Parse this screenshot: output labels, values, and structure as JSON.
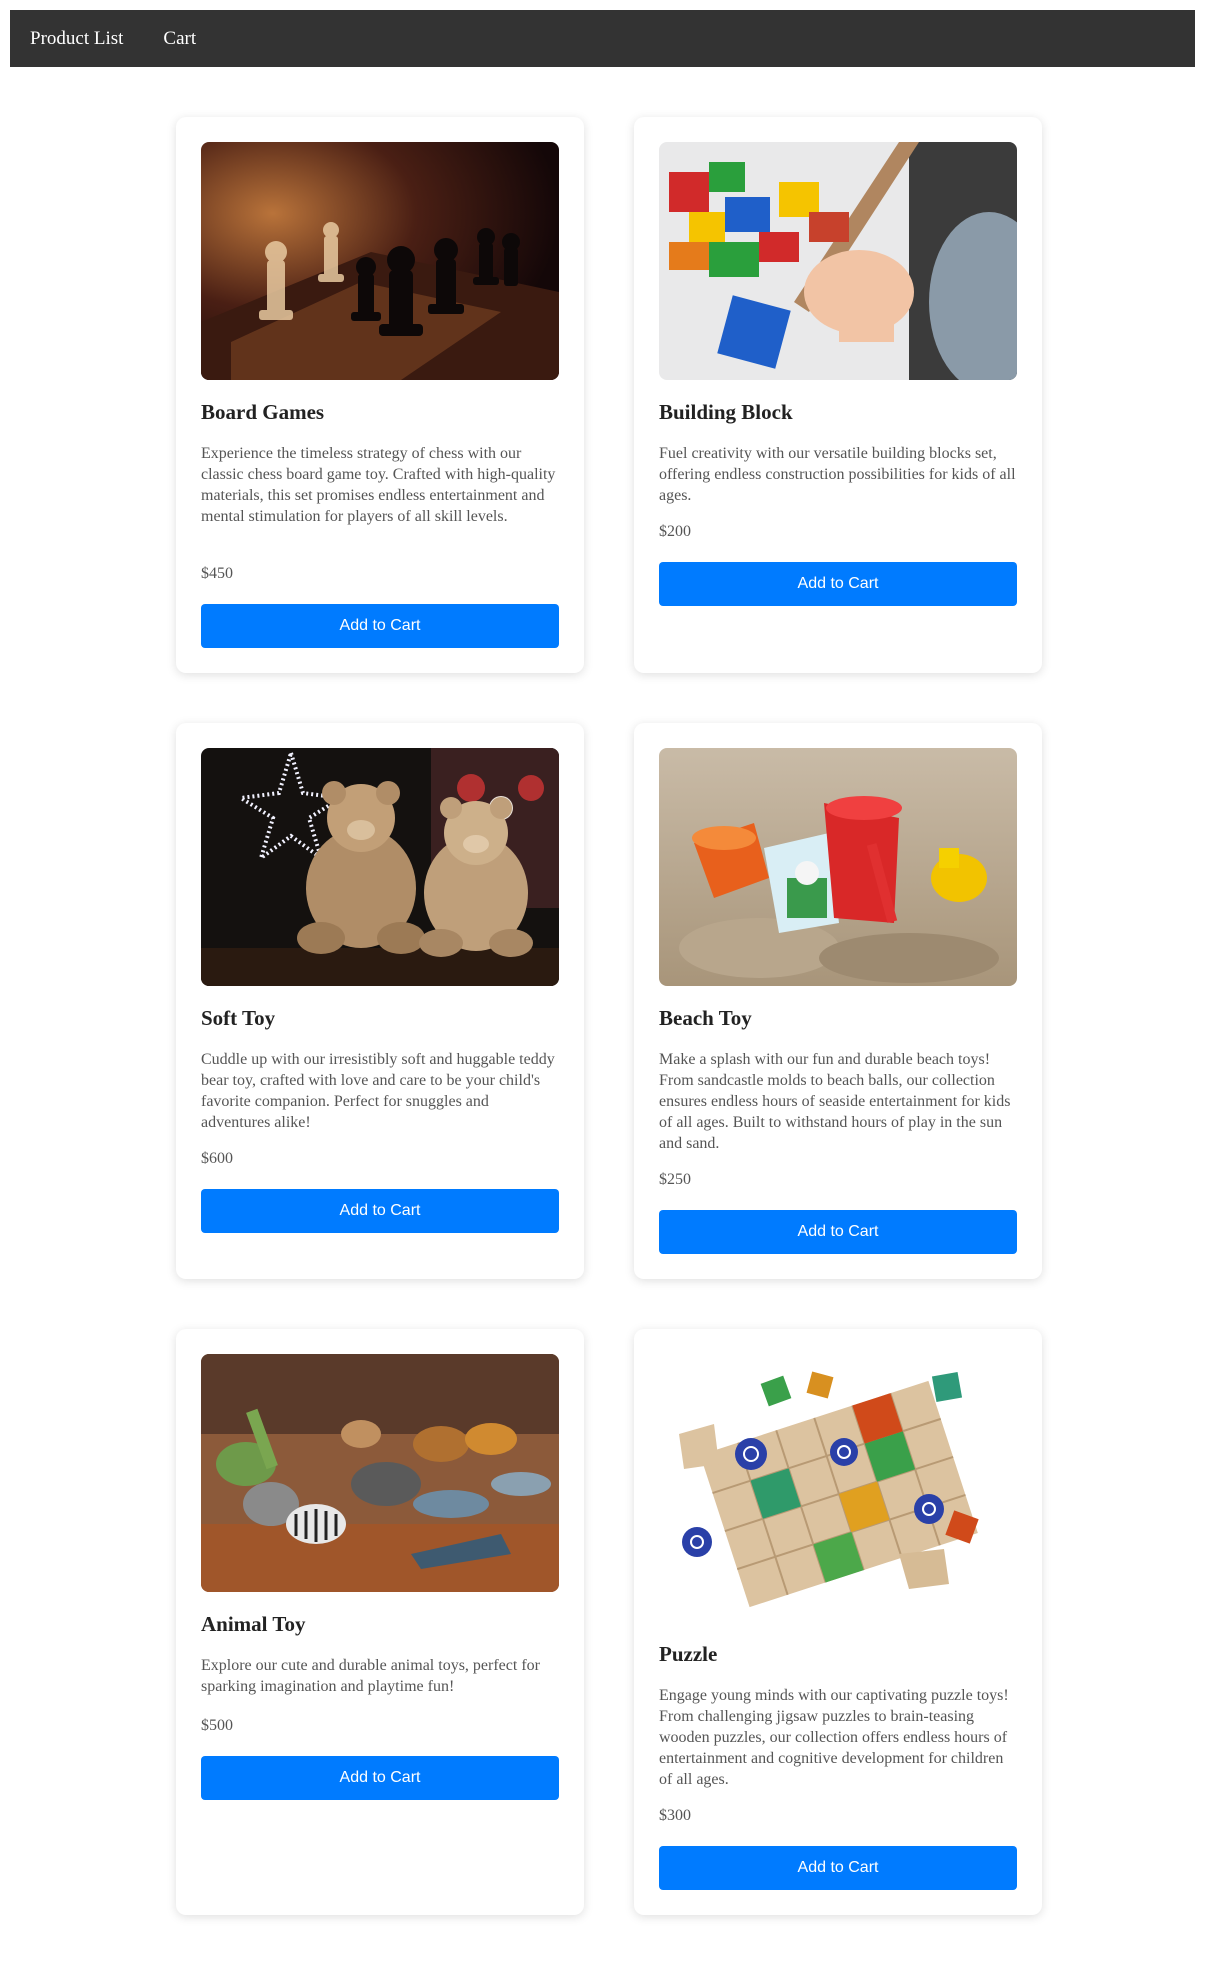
{
  "nav": {
    "items": [
      {
        "label": "Product List"
      },
      {
        "label": "Cart"
      }
    ]
  },
  "colors": {
    "nav_bg": "#333333",
    "button_bg": "#007bff",
    "button_text": "#ffffff"
  },
  "products": [
    {
      "title": "Board Games",
      "description": "Experience the timeless strategy of chess with our classic chess board game toy. Crafted with high-quality materials, this set promises endless entertainment and mental stimulation for players of all skill levels.",
      "price": "$450",
      "button": "Add to Cart",
      "image_icon": "chess-image"
    },
    {
      "title": "Building Block",
      "description": "Fuel creativity with our versatile building blocks set, offering endless construction possibilities for kids of all ages.",
      "price": "$200",
      "button": "Add to Cart",
      "image_icon": "building-blocks-image"
    },
    {
      "title": "Soft Toy",
      "description": "Cuddle up with our irresistibly soft and huggable teddy bear toy, crafted with love and care to be your child's favorite companion. Perfect for snuggles and adventures alike!",
      "price": "$600",
      "button": "Add to Cart",
      "image_icon": "teddy-bears-image"
    },
    {
      "title": "Beach Toy",
      "description": "Make a splash with our fun and durable beach toys! From sandcastle molds to beach balls, our collection ensures endless hours of seaside entertainment for kids of all ages. Built to withstand hours of play in the sun and sand.",
      "price": "$250",
      "button": "Add to Cart",
      "image_icon": "beach-toys-image"
    },
    {
      "title": "Animal Toy",
      "description": "Explore our cute and durable animal toys, perfect for sparking imagination and playtime fun!",
      "price": "$500",
      "button": "Add to Cart",
      "image_icon": "animal-figures-image"
    },
    {
      "title": "Puzzle",
      "description": "Engage young minds with our captivating puzzle toys! From challenging jigsaw puzzles to brain-teasing wooden puzzles, our collection offers endless hours of entertainment and cognitive development for children of all ages.",
      "price": "$300",
      "button": "Add to Cart",
      "image_icon": "wooden-puzzle-image"
    }
  ]
}
